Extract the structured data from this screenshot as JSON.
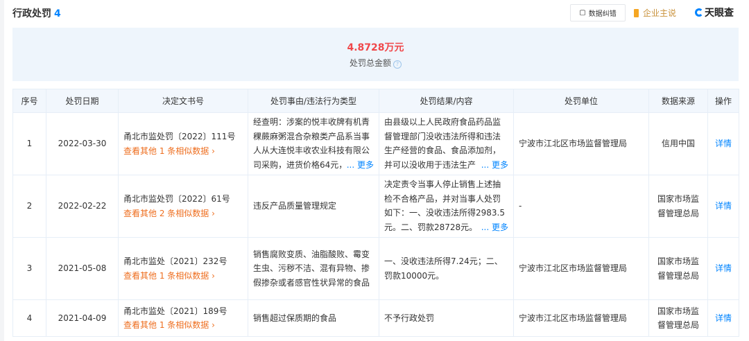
{
  "header": {
    "title": "行政处罚",
    "count": "4",
    "error_btn": "数据纠错",
    "owner": "企业主说",
    "logo": "天眼查"
  },
  "summary": {
    "amount": "4.8728万元",
    "label": "处罚总金额"
  },
  "table": {
    "columns": [
      "序号",
      "处罚日期",
      "决定文书号",
      "处罚事由/违法行为类型",
      "处罚结果/内容",
      "处罚单位",
      "数据来源",
      "操作"
    ],
    "rows": [
      {
        "no": "1",
        "date": "2022-03-30",
        "doc": "甬北市监处罚〔2022〕111号",
        "similar": "查看其他 1 条相似数据",
        "reason": "经查明：涉案的悦丰收牌有机青稞蕨麻粥混合杂粮类产品系当事人从大连悦丰收农业科技有限公司采购，进货价格64元，",
        "reason_more": "... 更多",
        "result": "由县级以上人民政府食品药品监督管理部门没收违法所得和违法生产经营的食品、食品添加剂，并可以没收用于违法生产",
        "result_more": "... 更多",
        "unit": "宁波市江北区市场监督管理局",
        "source": "信用中国",
        "action": "详情"
      },
      {
        "no": "2",
        "date": "2022-02-22",
        "doc": "甬北市监处罚〔2022〕61号",
        "similar": "查看其他 2 条相似数据",
        "reason": "违反产品质量管理规定",
        "result": "决定责令当事人停止销售上述抽检不合格产品，并对当事人处罚如下：一、没收违法所得2983.5元。二、罚款28728元。",
        "result_more": "... 更多",
        "unit": "-",
        "source": "国家市场监督管理总局",
        "action": "详情"
      },
      {
        "no": "3",
        "date": "2021-05-08",
        "doc": "甬北市监处〔2021〕232号",
        "similar": "查看其他 1 条相似数据",
        "reason": "销售腐败变质、油脂酸败、霉变生虫、污秽不洁、混有异物、掺假掺杂或者感官性状异常的食品",
        "result": "一、没收违法所得7.24元；二、罚款10000元。",
        "unit": "宁波市江北区市场监督管理局",
        "source": "国家市场监督管理总局",
        "action": "详情"
      },
      {
        "no": "4",
        "date": "2021-04-09",
        "doc": "甬北市监处〔2021〕189号",
        "similar": "查看其他 1 条相似数据",
        "reason": "销售超过保质期的食品",
        "result": "不予行政处罚",
        "unit": "宁波市江北区市场监督管理局",
        "source": "国家市场监督管理总局",
        "action": "详情"
      }
    ]
  },
  "colors": {
    "accent": "#0084ff",
    "amount": "#f0474a",
    "similar": "#ee6e1f"
  }
}
